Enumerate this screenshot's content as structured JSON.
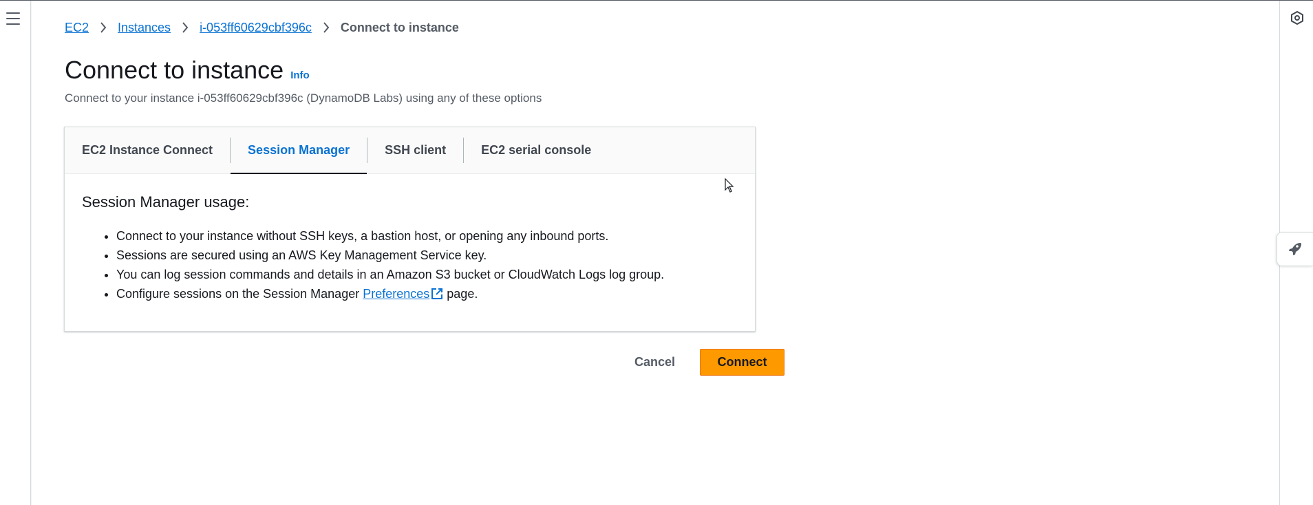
{
  "breadcrumb": {
    "items": [
      {
        "label": "EC2"
      },
      {
        "label": "Instances"
      },
      {
        "label": "i-053ff60629cbf396c"
      }
    ],
    "current": "Connect to instance"
  },
  "header": {
    "title": "Connect to instance",
    "info_label": "Info",
    "description": "Connect to your instance i-053ff60629cbf396c (DynamoDB Labs) using any of these options"
  },
  "tabs": [
    {
      "label": "EC2 Instance Connect",
      "active": false
    },
    {
      "label": "Session Manager",
      "active": true
    },
    {
      "label": "SSH client",
      "active": false
    },
    {
      "label": "EC2 serial console",
      "active": false
    }
  ],
  "session_manager": {
    "title": "Session Manager usage:",
    "bullets": [
      "Connect to your instance without SSH keys, a bastion host, or opening any inbound ports.",
      "Sessions are secured using an AWS Key Management Service key.",
      "You can log session commands and details in an Amazon S3 bucket or CloudWatch Logs log group."
    ],
    "last_bullet": {
      "prefix": "Configure sessions on the Session Manager ",
      "link": "Preferences",
      "suffix": " page."
    }
  },
  "actions": {
    "cancel_label": "Cancel",
    "connect_label": "Connect"
  },
  "icons": {
    "menu": "hamburger-menu-icon",
    "settings": "hexagon-settings-icon",
    "rocket": "rocket-icon",
    "external": "external-link-icon",
    "chevron": "chevron-right-icon"
  },
  "colors": {
    "link": "#0972d3",
    "primary_button": "#ff9900",
    "text": "#16191f",
    "muted": "#545b64"
  }
}
